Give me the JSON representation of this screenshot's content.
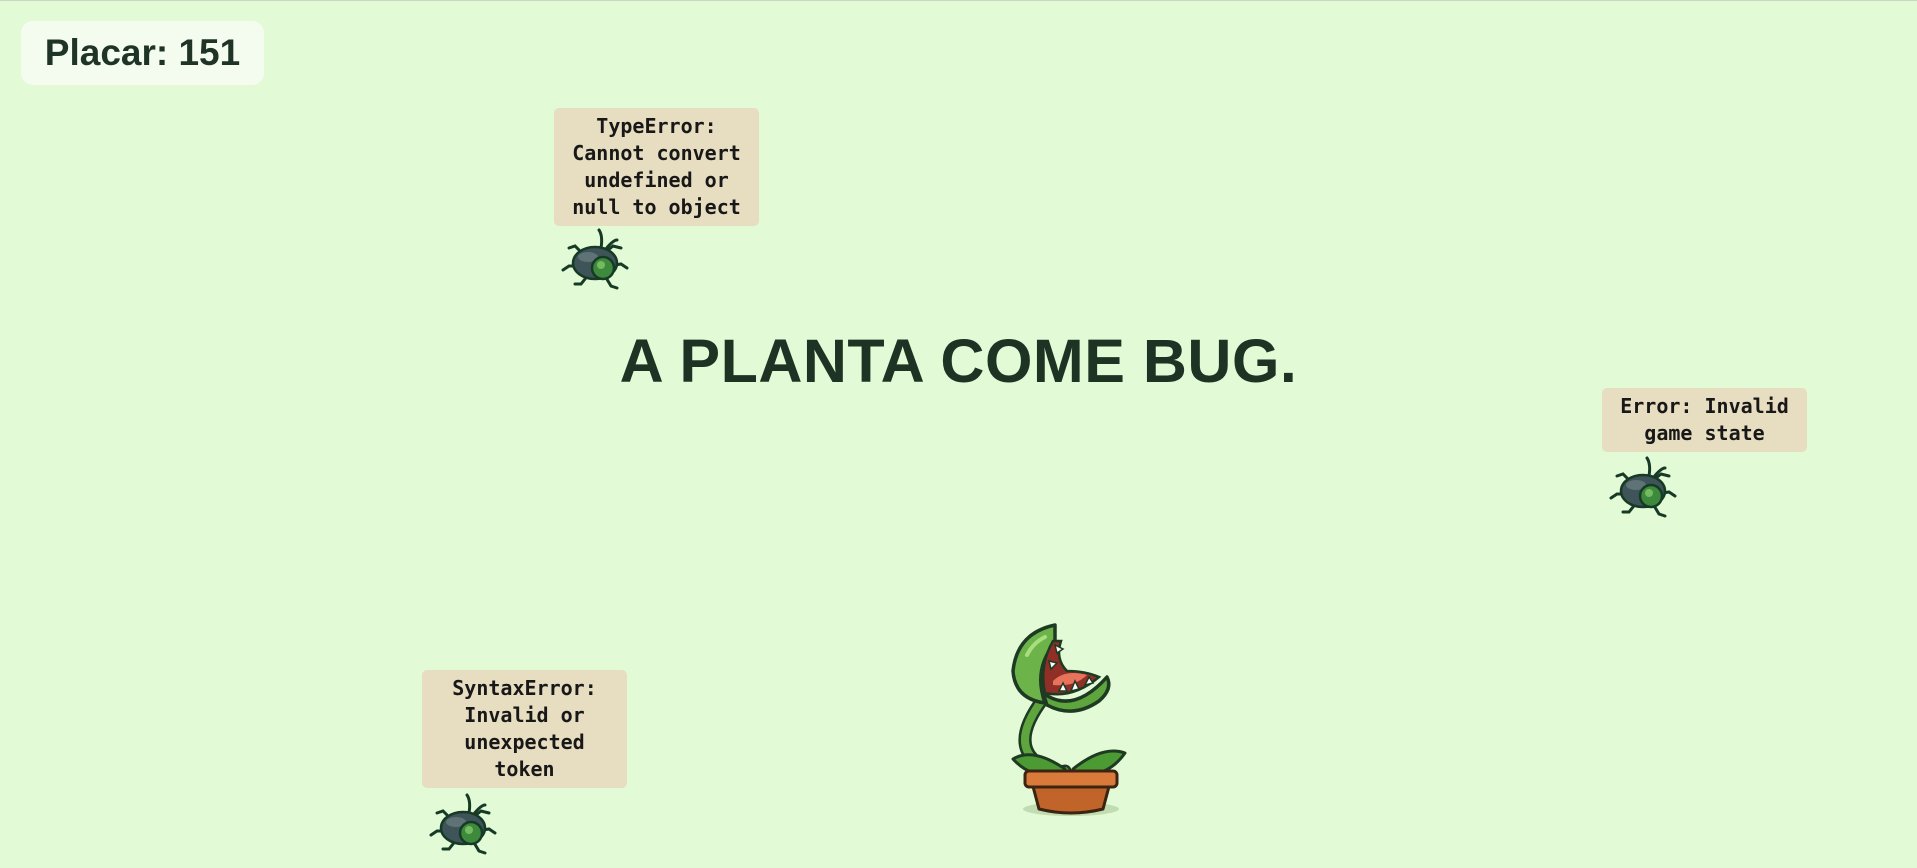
{
  "hud": {
    "score_label": "Placar: 151"
  },
  "headline": "A PLANTA COME BUG.",
  "bugs": [
    {
      "error": "TypeError:\nCannot convert\nundefined or\nnull to object",
      "icon": "beetle-icon"
    },
    {
      "error": "Error: Invalid\ngame state",
      "icon": "beetle-icon"
    },
    {
      "error": "SyntaxError:\nInvalid or\nunexpected\ntoken",
      "icon": "beetle-icon"
    }
  ],
  "player": {
    "icon": "venus-flytrap-icon"
  },
  "colors": {
    "background": "#e2fad6",
    "score_panel": "#f4fcf0",
    "bubble": "#e7ddc1",
    "text_dark": "#1d3323"
  }
}
